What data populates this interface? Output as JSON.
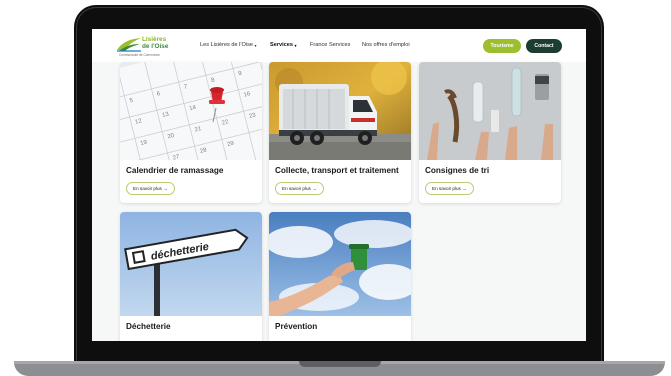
{
  "header": {
    "logo": {
      "line1": "Lisières",
      "line2": "de l'Oise",
      "tagline": "Communauté de Communes",
      "icon": "leaf-logo-icon"
    },
    "nav": [
      {
        "label": "Les Lisières de l'Oise",
        "has_dropdown": true
      },
      {
        "label": "Services",
        "has_dropdown": true,
        "active": true
      },
      {
        "label": "France Services",
        "has_dropdown": false
      },
      {
        "label": "Nos offres d'emploi",
        "has_dropdown": false
      }
    ],
    "caret_glyph": "▾",
    "buttons": {
      "tourisme": "Tourisme",
      "contact": "Contact"
    }
  },
  "cards": [
    {
      "title": "Calendrier de ramassage",
      "link": "En savoir plus",
      "image": "calendar-with-red-pushpin"
    },
    {
      "title": "Collecte, transport et traitement",
      "link": "En savoir plus",
      "image": "garbage-truck"
    },
    {
      "title": "Consignes de tri",
      "link": "En savoir plus",
      "image": "hands-holding-recyclables"
    },
    {
      "title": "Déchetterie",
      "link": "",
      "image": "dechetterie-street-sign",
      "sign_text": "déchetterie"
    },
    {
      "title": "Prévention",
      "link": "",
      "image": "hand-holding-green-bin-in-sky"
    }
  ],
  "link_arrow": "→",
  "colors": {
    "accent_green": "#9dbe2f",
    "dark_green": "#1d3d33",
    "link_border": "#b8cc74",
    "page_bg": "#f6f7f7"
  }
}
